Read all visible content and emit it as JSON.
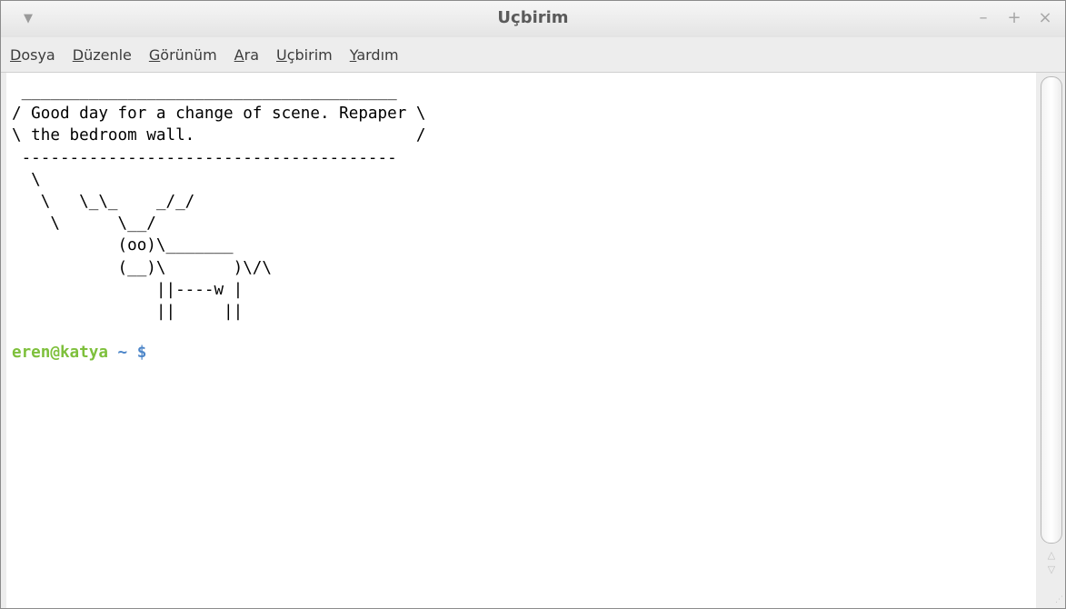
{
  "window": {
    "title": "Uçbirim",
    "menu_icon": "window-menu-icon",
    "controls": {
      "minimize": "–",
      "maximize": "+",
      "close": "×"
    }
  },
  "menubar": {
    "items": [
      {
        "mnemonic": "D",
        "rest": "osya"
      },
      {
        "mnemonic": "D",
        "rest": "üzenle"
      },
      {
        "mnemonic": "G",
        "rest": "örünüm"
      },
      {
        "mnemonic": "A",
        "rest": "ra"
      },
      {
        "mnemonic": "U",
        "rest": "çbirim"
      },
      {
        "mnemonic": "Y",
        "rest": "ardım"
      }
    ]
  },
  "terminal": {
    "output": " _______________________________________\n/ Good day for a change of scene. Repaper \\\n\\ the bedroom wall.                       /\n ---------------------------------------\n  \\\n   \\   \\_\\_    _/_/\n    \\      \\__/\n           (oo)\\_______\n           (__)\\       )\\/\\\n               ||----w |\n               ||     ||",
    "prompt": {
      "user_host": "eren@katya",
      "dir": "~",
      "symbol": "$"
    }
  },
  "scrollbar": {
    "up_arrow": "△",
    "down_arrow": "▽",
    "grip": "⋰"
  }
}
